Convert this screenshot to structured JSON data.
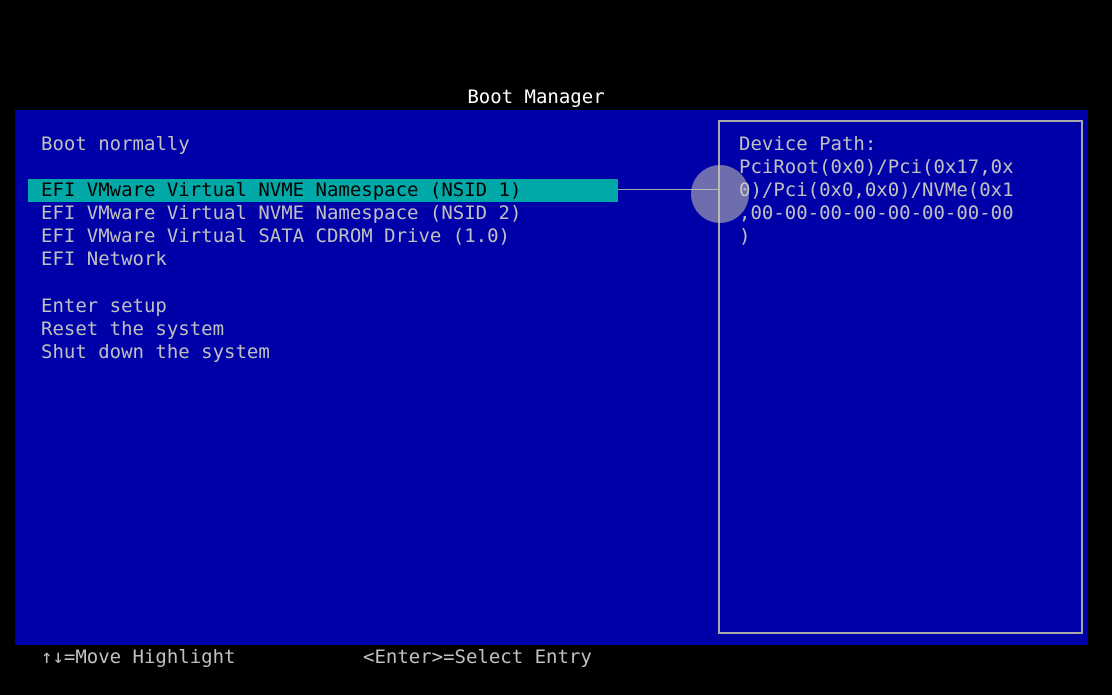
{
  "screen": {
    "title": "Boot Manager"
  },
  "menu": {
    "items": [
      {
        "label": "Boot normally"
      },
      {
        "label": "EFI VMware Virtual NVME Namespace (NSID 1)"
      },
      {
        "label": "EFI VMware Virtual NVME Namespace (NSID 2)"
      },
      {
        "label": "EFI VMware Virtual SATA CDROM Drive (1.0)"
      },
      {
        "label": "EFI Network"
      },
      {
        "label": "Enter setup"
      },
      {
        "label": "Reset the system"
      },
      {
        "label": "Shut down the system"
      }
    ],
    "selected": "EFI VMware Virtual NVME Namespace (NSID 1)"
  },
  "help": {
    "title": "Device Path:",
    "lines": [
      "PciRoot(0x0)/Pci(0x17,0x",
      "0)/Pci(0x0,0x0)/NVMe(0x1",
      ",00-00-00-00-00-00-00-00",
      ")"
    ]
  },
  "footer": {
    "move_hint": "↑↓=Move Highlight",
    "select_hint": "<Enter>=Select Entry"
  },
  "colors": {
    "panel_background": "#0000a8",
    "highlight_background": "#00a8a8",
    "text": "#c0c0c0",
    "title_text": "#ffffff"
  }
}
